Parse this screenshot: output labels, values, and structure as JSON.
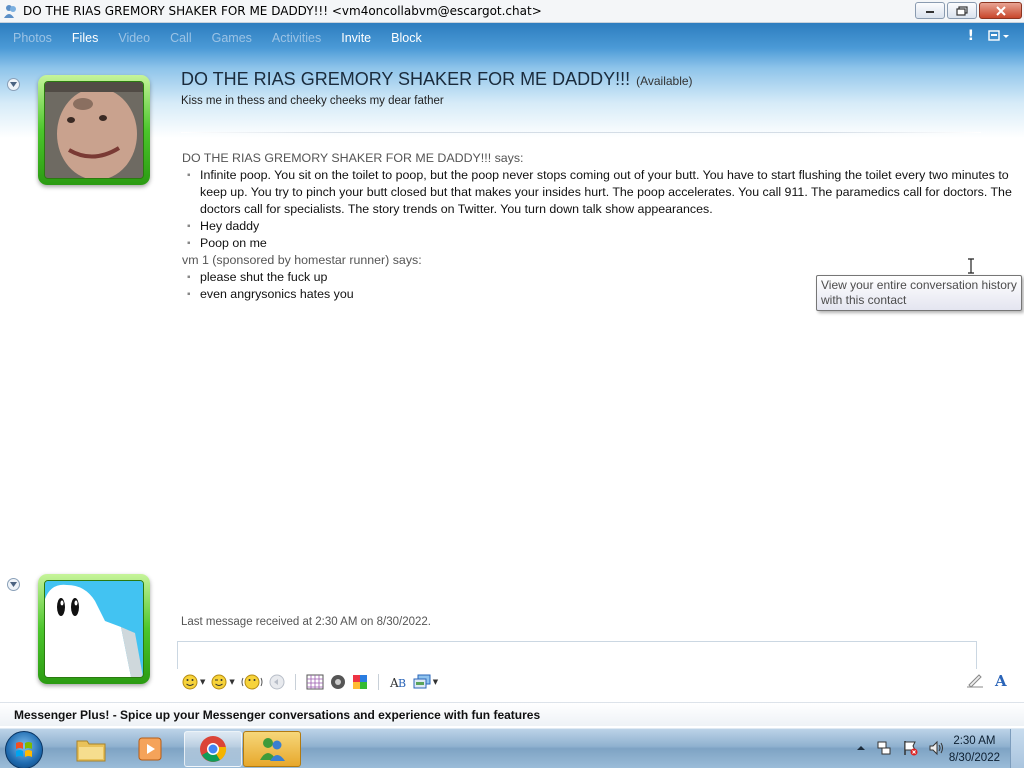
{
  "window": {
    "title": "DO THE RIAS GREMORY SHAKER FOR ME DADDY!!! <vm4oncollabvm@escargot.chat>"
  },
  "toolbar": {
    "items": [
      {
        "label": "Photos",
        "enabled": false
      },
      {
        "label": "Files",
        "enabled": true
      },
      {
        "label": "Video",
        "enabled": false
      },
      {
        "label": "Call",
        "enabled": false
      },
      {
        "label": "Games",
        "enabled": false
      },
      {
        "label": "Activities",
        "enabled": false
      },
      {
        "label": "Invite",
        "enabled": true
      },
      {
        "label": "Block",
        "enabled": true
      }
    ]
  },
  "contact": {
    "name": "DO THE RIAS GREMORY SHAKER FOR ME DADDY!!!",
    "status": "(Available)",
    "personal_message": "Kiss me in thess and cheeky cheeks my dear father"
  },
  "conversation": {
    "sender1": {
      "says": "DO THE RIAS GREMORY SHAKER FOR ME DADDY!!! says:",
      "messages": [
        "Infinite poop. You sit on the toilet to poop, but the poop never stops coming out of your butt. You have to start flushing the toilet every two minutes to keep up. You try to pinch your butt closed but that makes your insides hurt. The poop accelerates. You call 911. The paramedics call for doctors. The doctors call for specialists. The story trends on Twitter. You turn down talk show appearances.",
        "Hey daddy",
        "Poop on me"
      ]
    },
    "sender2": {
      "says": "vm 1 (sponsored by homestar runner) says:",
      "messages": [
        "please shut the fuck up",
        "even angrysonics hates you"
      ]
    }
  },
  "tooltip": {
    "text": "View your entire conversation history with this contact"
  },
  "footer": {
    "last_message": "Last message received at 2:30 AM on 8/30/2022.",
    "plus_banner": "Messenger Plus! - Spice up your Messenger conversations and experience with fun features"
  },
  "taskbar": {
    "time": "2:30 AM",
    "date": "8/30/2022"
  },
  "colors": {
    "header_blue": "#2d7dbf",
    "avatar_green": "#4cc62c"
  }
}
